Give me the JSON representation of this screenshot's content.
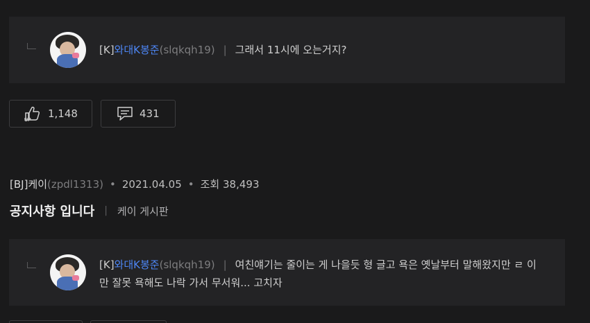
{
  "comment1": {
    "prefix": "[K]",
    "nickname": "와대K봉준",
    "user_id": "(slqkqh19)",
    "separator": "|",
    "text": "그래서 11시에 오는거지?"
  },
  "actions": {
    "like_count": "1,148",
    "comment_count": "431"
  },
  "post": {
    "author": "[BJ]케이",
    "author_id": "(zpdl1313)",
    "date": "2021.04.05",
    "views_label": "조회",
    "views": "38,493",
    "bullet": "•",
    "title": "공지사항 입니다",
    "board_separator": "|",
    "board": "케이 게시판"
  },
  "comment2": {
    "prefix": "[K]",
    "nickname": "와대K봉준",
    "user_id": "(slqkqh19)",
    "separator": "|",
    "text_line1": "여친얘기는 줄이는 게 나을듯 형 글고 욕은 옛날부터 말해왔지만 ㄹ 이",
    "text_line2": "만 잘못 욕해도 나락 가서 무서워... 고치자"
  },
  "icons": {
    "like": "thumbs-up-icon",
    "comment": "speech-bubble-icon",
    "reply": "reply-arrow-icon"
  },
  "colors": {
    "background": "#1a1a1b",
    "comment_box": "#232325",
    "nickname": "#4d86f5",
    "border": "#3d3d3f"
  }
}
